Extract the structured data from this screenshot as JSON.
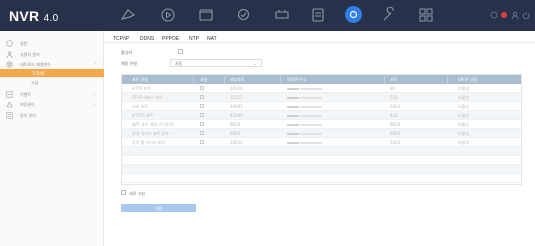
{
  "app": {
    "logo": "NVR",
    "version": "4.0"
  },
  "topbar": {
    "icons": [
      "live-view-icon",
      "playback-icon",
      "file-icon",
      "search-icon",
      "hdd-icon",
      "storage-icon",
      "settings-icon",
      "maintenance-icon",
      "grid-icon"
    ],
    "active_icon": "settings-icon",
    "status_icons": [
      "network-status-icon",
      "record-status-icon",
      "user-icon",
      "power-icon"
    ]
  },
  "sidebar": {
    "items": [
      {
        "id": "general",
        "label": "일반",
        "icon": "monitor-icon"
      },
      {
        "id": "user",
        "label": "사용자 관리",
        "icon": "user-icon"
      },
      {
        "id": "network",
        "label": "네트워크 매개변수",
        "icon": "globe-icon",
        "expanded": true
      },
      {
        "id": "alarm",
        "label": "이벤트",
        "icon": "alarm-icon"
      },
      {
        "id": "storage",
        "label": "저장관리",
        "icon": "storage-icon"
      },
      {
        "id": "system",
        "label": "장치 관리",
        "icon": "device-icon"
      }
    ],
    "subitems": [
      {
        "id": "tcpip",
        "label": "TCP/IP",
        "active": true
      },
      {
        "id": "advanced",
        "label": "고급"
      }
    ]
  },
  "tabs": [
    {
      "id": "tcpip",
      "label": "TCP/IP"
    },
    {
      "id": "ddns",
      "label": "DDNS"
    },
    {
      "id": "pppoe",
      "label": "PPPOE"
    },
    {
      "id": "ntp",
      "label": "NTP"
    },
    {
      "id": "nat",
      "label": "NAT",
      "active": true
    }
  ],
  "form": {
    "enable_label": "활성화",
    "mapping_label": "매핑 유형",
    "mapping_value": "자동",
    "refresh_label": "새로 고침",
    "apply_label": "적용"
  },
  "table": {
    "columns": [
      "포트 유형",
      "사용",
      "외부포트",
      "외부IP 주소",
      "포트",
      "UPnP 상태"
    ],
    "rows": [
      [
        "HTTP 포트",
        "",
        "10016",
        "",
        "80",
        "비활성"
      ],
      [
        "RTSP 서비스 포트",
        "",
        "11071",
        "",
        "554",
        "비활성"
      ],
      [
        "서버 포트",
        "",
        "46003",
        "",
        "6003",
        "비활성"
      ],
      [
        "HTTPS 포트",
        "",
        "43009",
        "",
        "443",
        "비활성"
      ],
      [
        "NAT 포트 매핑 (FC원격)",
        "",
        "8010",
        "",
        "8010",
        "비활성"
      ],
      [
        "원격 서비스 포트 번호",
        "",
        "6000",
        "",
        "6000",
        "비활성"
      ],
      [
        "장치 웹 서비스 포트",
        "",
        "20014",
        "",
        "5443",
        "비활성"
      ]
    ],
    "blank_rows": 4
  },
  "colors": {
    "topbar": "#27324a",
    "accent": "#f5a84b",
    "active_icon": "#2f7fe6",
    "table_header": "#a9bdd0",
    "apply_button": "#a8c8ee"
  }
}
